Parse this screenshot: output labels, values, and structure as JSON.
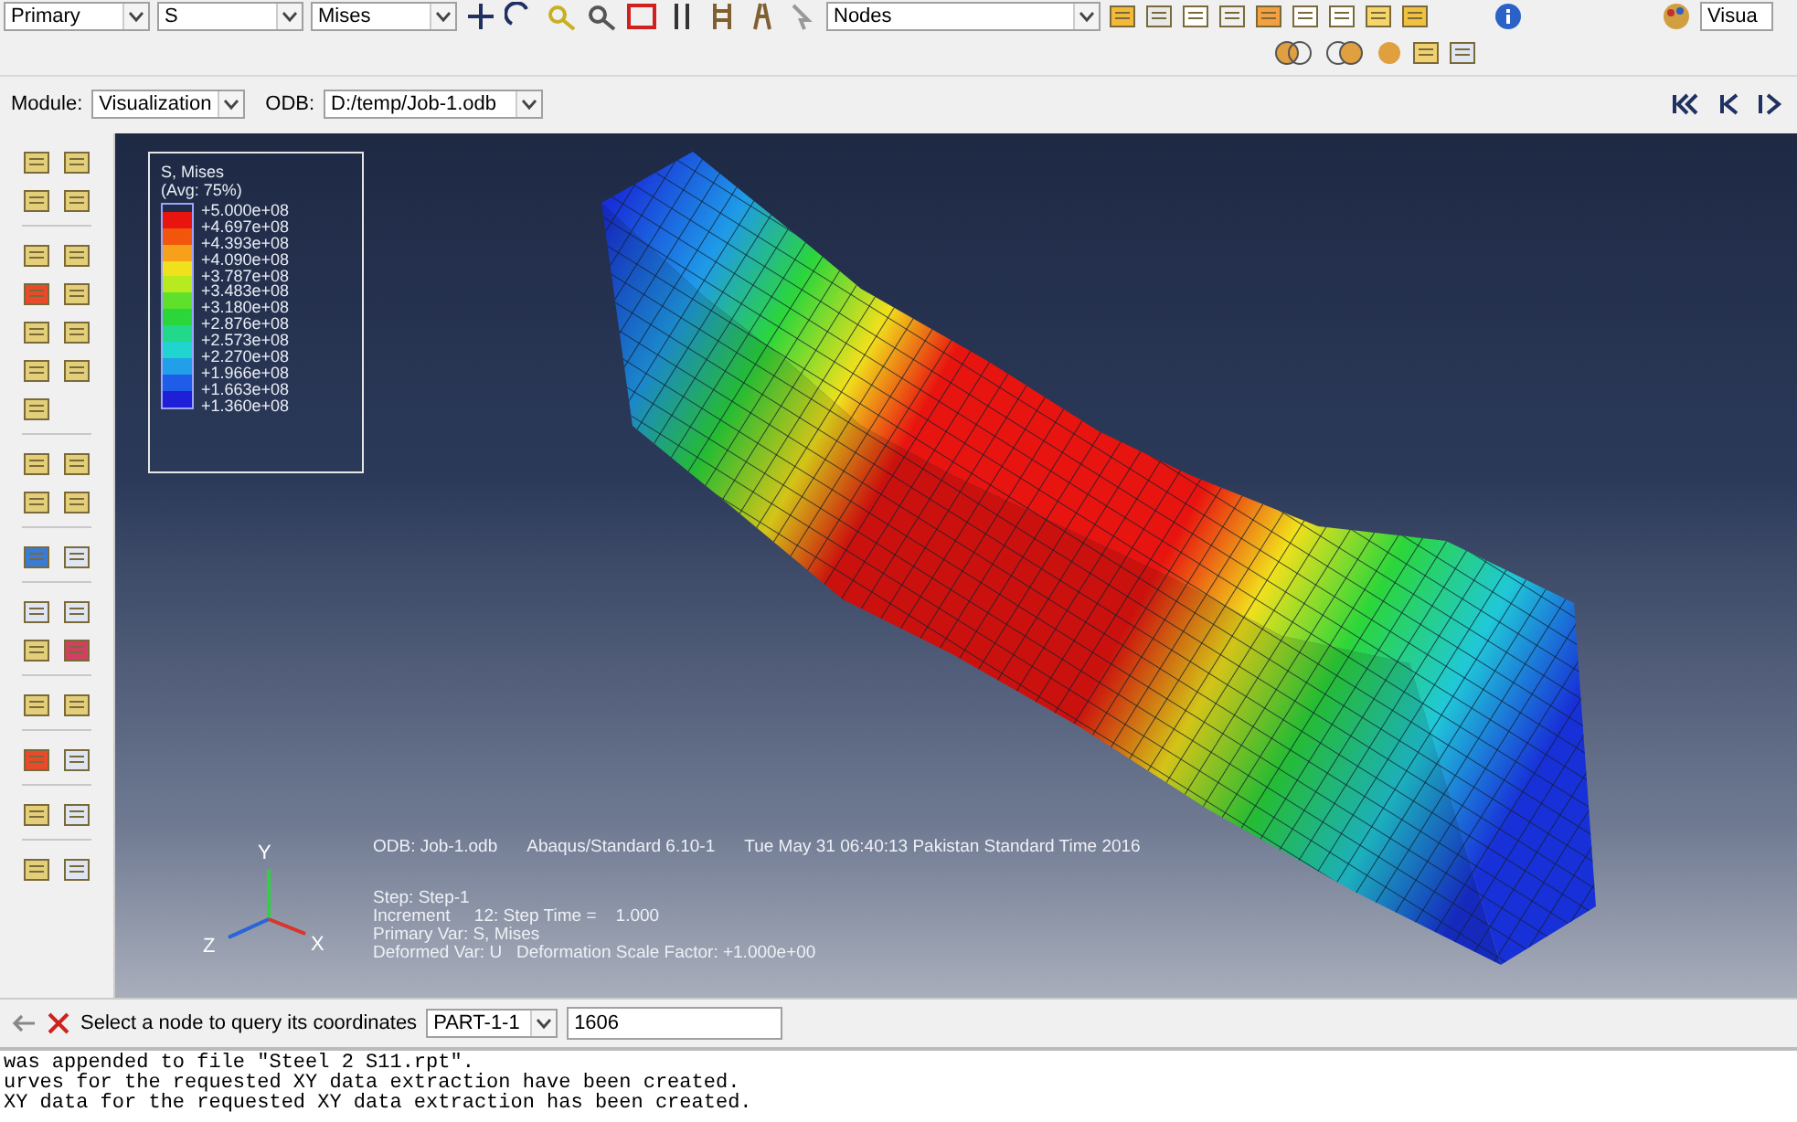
{
  "toolbar": {
    "combos": [
      {
        "value": "Primary"
      },
      {
        "value": "S"
      },
      {
        "value": "Mises"
      },
      {
        "value": "Nodes"
      }
    ],
    "cut_label": "Visua"
  },
  "module_bar": {
    "module_label": "Module:",
    "module": "Visualization",
    "odb_label": "ODB:",
    "odb": "D:/temp/Job-1.odb"
  },
  "legend": {
    "title": "S, Mises",
    "subtitle": "(Avg: 75%)",
    "ticks": [
      "+5.000e+08",
      "+4.697e+08",
      "+4.393e+08",
      "+4.090e+08",
      "+3.787e+08",
      "+3.483e+08",
      "+3.180e+08",
      "+2.876e+08",
      "+2.573e+08",
      "+2.270e+08",
      "+1.966e+08",
      "+1.663e+08",
      "+1.360e+08"
    ],
    "bands": [
      {
        "color": "#e8140f"
      },
      {
        "color": "#f2560c"
      },
      {
        "color": "#f7a11a"
      },
      {
        "color": "#f1e01c"
      },
      {
        "color": "#b7ea1f"
      },
      {
        "color": "#5fe02a"
      },
      {
        "color": "#2bd63a"
      },
      {
        "color": "#22d98a"
      },
      {
        "color": "#20d4d0"
      },
      {
        "color": "#219fe8"
      },
      {
        "color": "#1f5ce8"
      },
      {
        "color": "#1f1fd8"
      }
    ]
  },
  "viewport_info": {
    "header": [
      "ODB: Job-1.odb",
      "Abaqus/Standard 6.10-1",
      "Tue May 31 06:40:13 Pakistan Standard Time 2016"
    ],
    "lines": [
      "Step: Step-1",
      "Increment     12: Step Time =    1.000",
      "Primary Var: S, Mises",
      "Deformed Var: U   Deformation Scale Factor: +1.000e+00"
    ]
  },
  "triad": {
    "axes": [
      "Y",
      "Z",
      "X"
    ]
  },
  "prompt": {
    "text": "Select a node to query its coordinates",
    "part": "PART-1-1",
    "node": "1606"
  },
  "messages": [
    "was appended to file \"Steel 2 S11.rpt\".",
    "urves for the requested XY data extraction have been created.",
    "XY data for the requested XY data extraction has been created."
  ]
}
